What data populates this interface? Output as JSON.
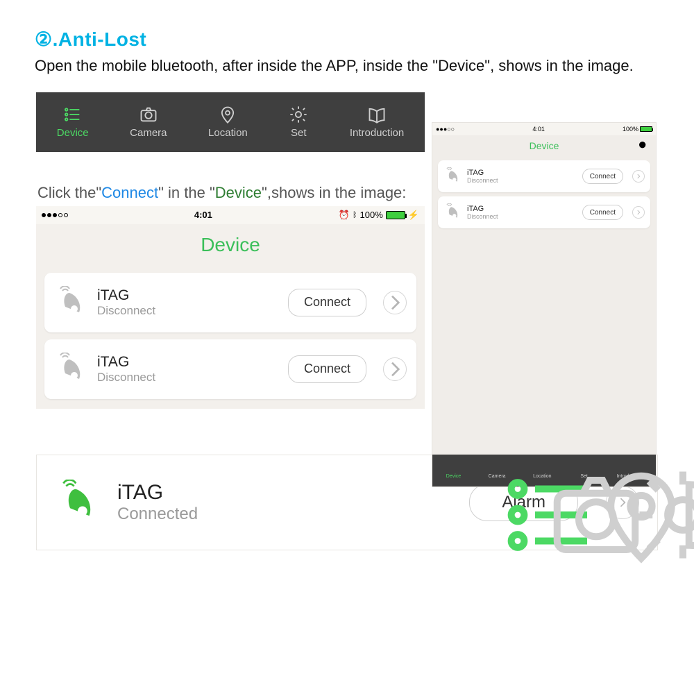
{
  "heading": "②.Anti-Lost",
  "body": "Open the mobile bluetooth, after inside the APP, inside the \"Device\", shows in the image.",
  "tabs": {
    "device": "Device",
    "camera": "Camera",
    "location": "Location",
    "set": "Set",
    "intro": "Introduction"
  },
  "instr": {
    "p1": "Click the\"",
    "connect": "Connect",
    "p2": "\" in the \"",
    "device": "Device",
    "p3": "\",shows in the image:"
  },
  "status": {
    "time": "4:01",
    "battery_pct": "100%"
  },
  "device_title": "Device",
  "cards": [
    {
      "name": "iTAG",
      "status": "Disconnect",
      "btn": "Connect"
    },
    {
      "name": "iTAG",
      "status": "Disconnect",
      "btn": "Connect"
    }
  ],
  "connected": {
    "name": "iTAG",
    "status": "Connected",
    "btn": "Alarm"
  },
  "phone": {
    "time": "4:01",
    "battery_pct": "100%",
    "title": "Device",
    "cards": [
      {
        "name": "iTAG",
        "status": "Disconnect",
        "btn": "Connect"
      },
      {
        "name": "iTAG",
        "status": "Disconnect",
        "btn": "Connect"
      }
    ],
    "tabs": {
      "device": "Device",
      "camera": "Camera",
      "location": "Location",
      "set": "Set",
      "intro": "Introduction"
    }
  }
}
